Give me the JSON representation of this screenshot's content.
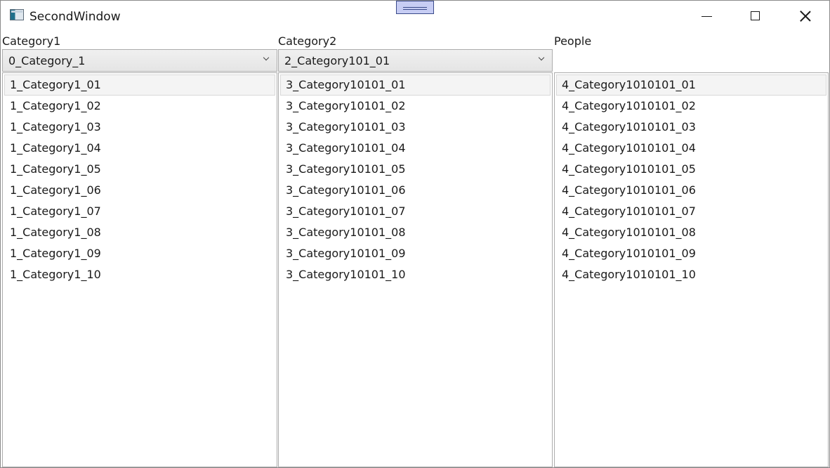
{
  "window": {
    "title": "SecondWindow"
  },
  "columns": [
    {
      "header": "Category1",
      "combo_value": "0_Category_1",
      "items": [
        "1_Category1_01",
        "1_Category1_02",
        "1_Category1_03",
        "1_Category1_04",
        "1_Category1_05",
        "1_Category1_06",
        "1_Category1_07",
        "1_Category1_08",
        "1_Category1_09",
        "1_Category1_10"
      ],
      "selected_index": 0
    },
    {
      "header": "Category2",
      "combo_value": "2_Category101_01",
      "items": [
        "3_Category10101_01",
        "3_Category10101_02",
        "3_Category10101_03",
        "3_Category10101_04",
        "3_Category10101_05",
        "3_Category10101_06",
        "3_Category10101_07",
        "3_Category10101_08",
        "3_Category10101_09",
        "3_Category10101_10"
      ],
      "selected_index": 0
    },
    {
      "header": "People",
      "items": [
        "4_Category1010101_01",
        "4_Category1010101_02",
        "4_Category1010101_03",
        "4_Category1010101_04",
        "4_Category1010101_05",
        "4_Category1010101_06",
        "4_Category1010101_07",
        "4_Category1010101_08",
        "4_Category1010101_09",
        "4_Category1010101_10"
      ],
      "selected_index": 0
    }
  ],
  "icons": {
    "app": "app-window-icon",
    "drag": "drag-handle-icon",
    "minimize": "minimize-icon",
    "maximize": "maximize-icon",
    "close": "close-icon",
    "dropdown": "chevron-down-icon"
  },
  "colors": {
    "selection_background": "#f4f4f4",
    "drag_handle": "#c7cdf4"
  }
}
